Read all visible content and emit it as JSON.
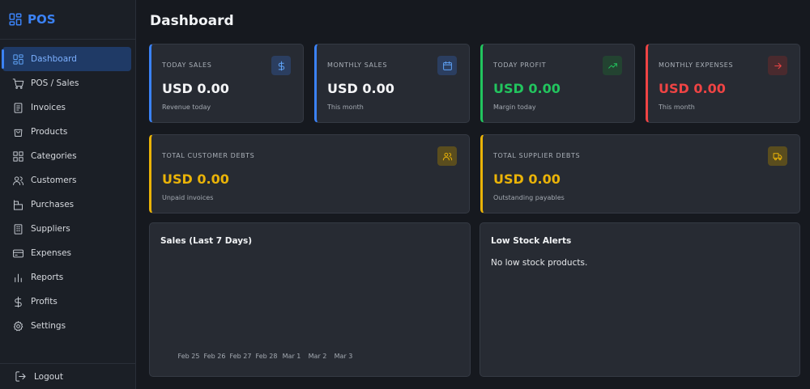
{
  "brand": {
    "name": "POS",
    "icon": "grid-icon",
    "color": "#3b82f6"
  },
  "sidebar": {
    "items": [
      {
        "label": "Dashboard",
        "icon": "grid-icon",
        "active": true
      },
      {
        "label": "POS / Sales",
        "icon": "cart-icon"
      },
      {
        "label": "Invoices",
        "icon": "document-icon"
      },
      {
        "label": "Products",
        "icon": "bag-icon"
      },
      {
        "label": "Categories",
        "icon": "squares-icon"
      },
      {
        "label": "Customers",
        "icon": "users-icon"
      },
      {
        "label": "Purchases",
        "icon": "purchases-icon"
      },
      {
        "label": "Suppliers",
        "icon": "building-icon"
      },
      {
        "label": "Expenses",
        "icon": "credit-card-icon"
      },
      {
        "label": "Reports",
        "icon": "bar-chart-icon"
      },
      {
        "label": "Profits",
        "icon": "dollar-icon"
      },
      {
        "label": "Settings",
        "icon": "gear-icon"
      }
    ],
    "logout_label": "Logout"
  },
  "page_title": "Dashboard",
  "stats": {
    "today_sales": {
      "label": "TODAY SALES",
      "value": "USD 0.00",
      "sub": "Revenue today",
      "icon": "dollar-icon",
      "color": "#3b82f6"
    },
    "monthly_sales": {
      "label": "MONTHLY SALES",
      "value": "USD 0.00",
      "sub": "This month",
      "icon": "calendar-icon",
      "color": "#3b82f6"
    },
    "today_profit": {
      "label": "TODAY PROFIT",
      "value": "USD 0.00",
      "sub": "Margin today",
      "icon": "trending-up-icon",
      "color": "#22c55e"
    },
    "monthly_expenses": {
      "label": "MONTHLY EXPENSES",
      "value": "USD 0.00",
      "sub": "This month",
      "icon": "arrow-right-icon",
      "color": "#ef4444"
    },
    "customer_debts": {
      "label": "TOTAL CUSTOMER DEBTS",
      "value": "USD 0.00",
      "sub": "Unpaid invoices",
      "icon": "users-icon",
      "color": "#eab308"
    },
    "supplier_debts": {
      "label": "TOTAL SUPPLIER DEBTS",
      "value": "USD 0.00",
      "sub": "Outstanding payables",
      "icon": "truck-icon",
      "color": "#eab308"
    }
  },
  "sales_chart": {
    "title": "Sales (Last 7 Days)",
    "x_labels": [
      "Feb 25",
      "Feb 26",
      "Feb 27",
      "Feb 28",
      "Mar 1",
      "Mar 2",
      "Mar 3"
    ]
  },
  "low_stock": {
    "title": "Low Stock Alerts",
    "message": "No low stock products."
  }
}
